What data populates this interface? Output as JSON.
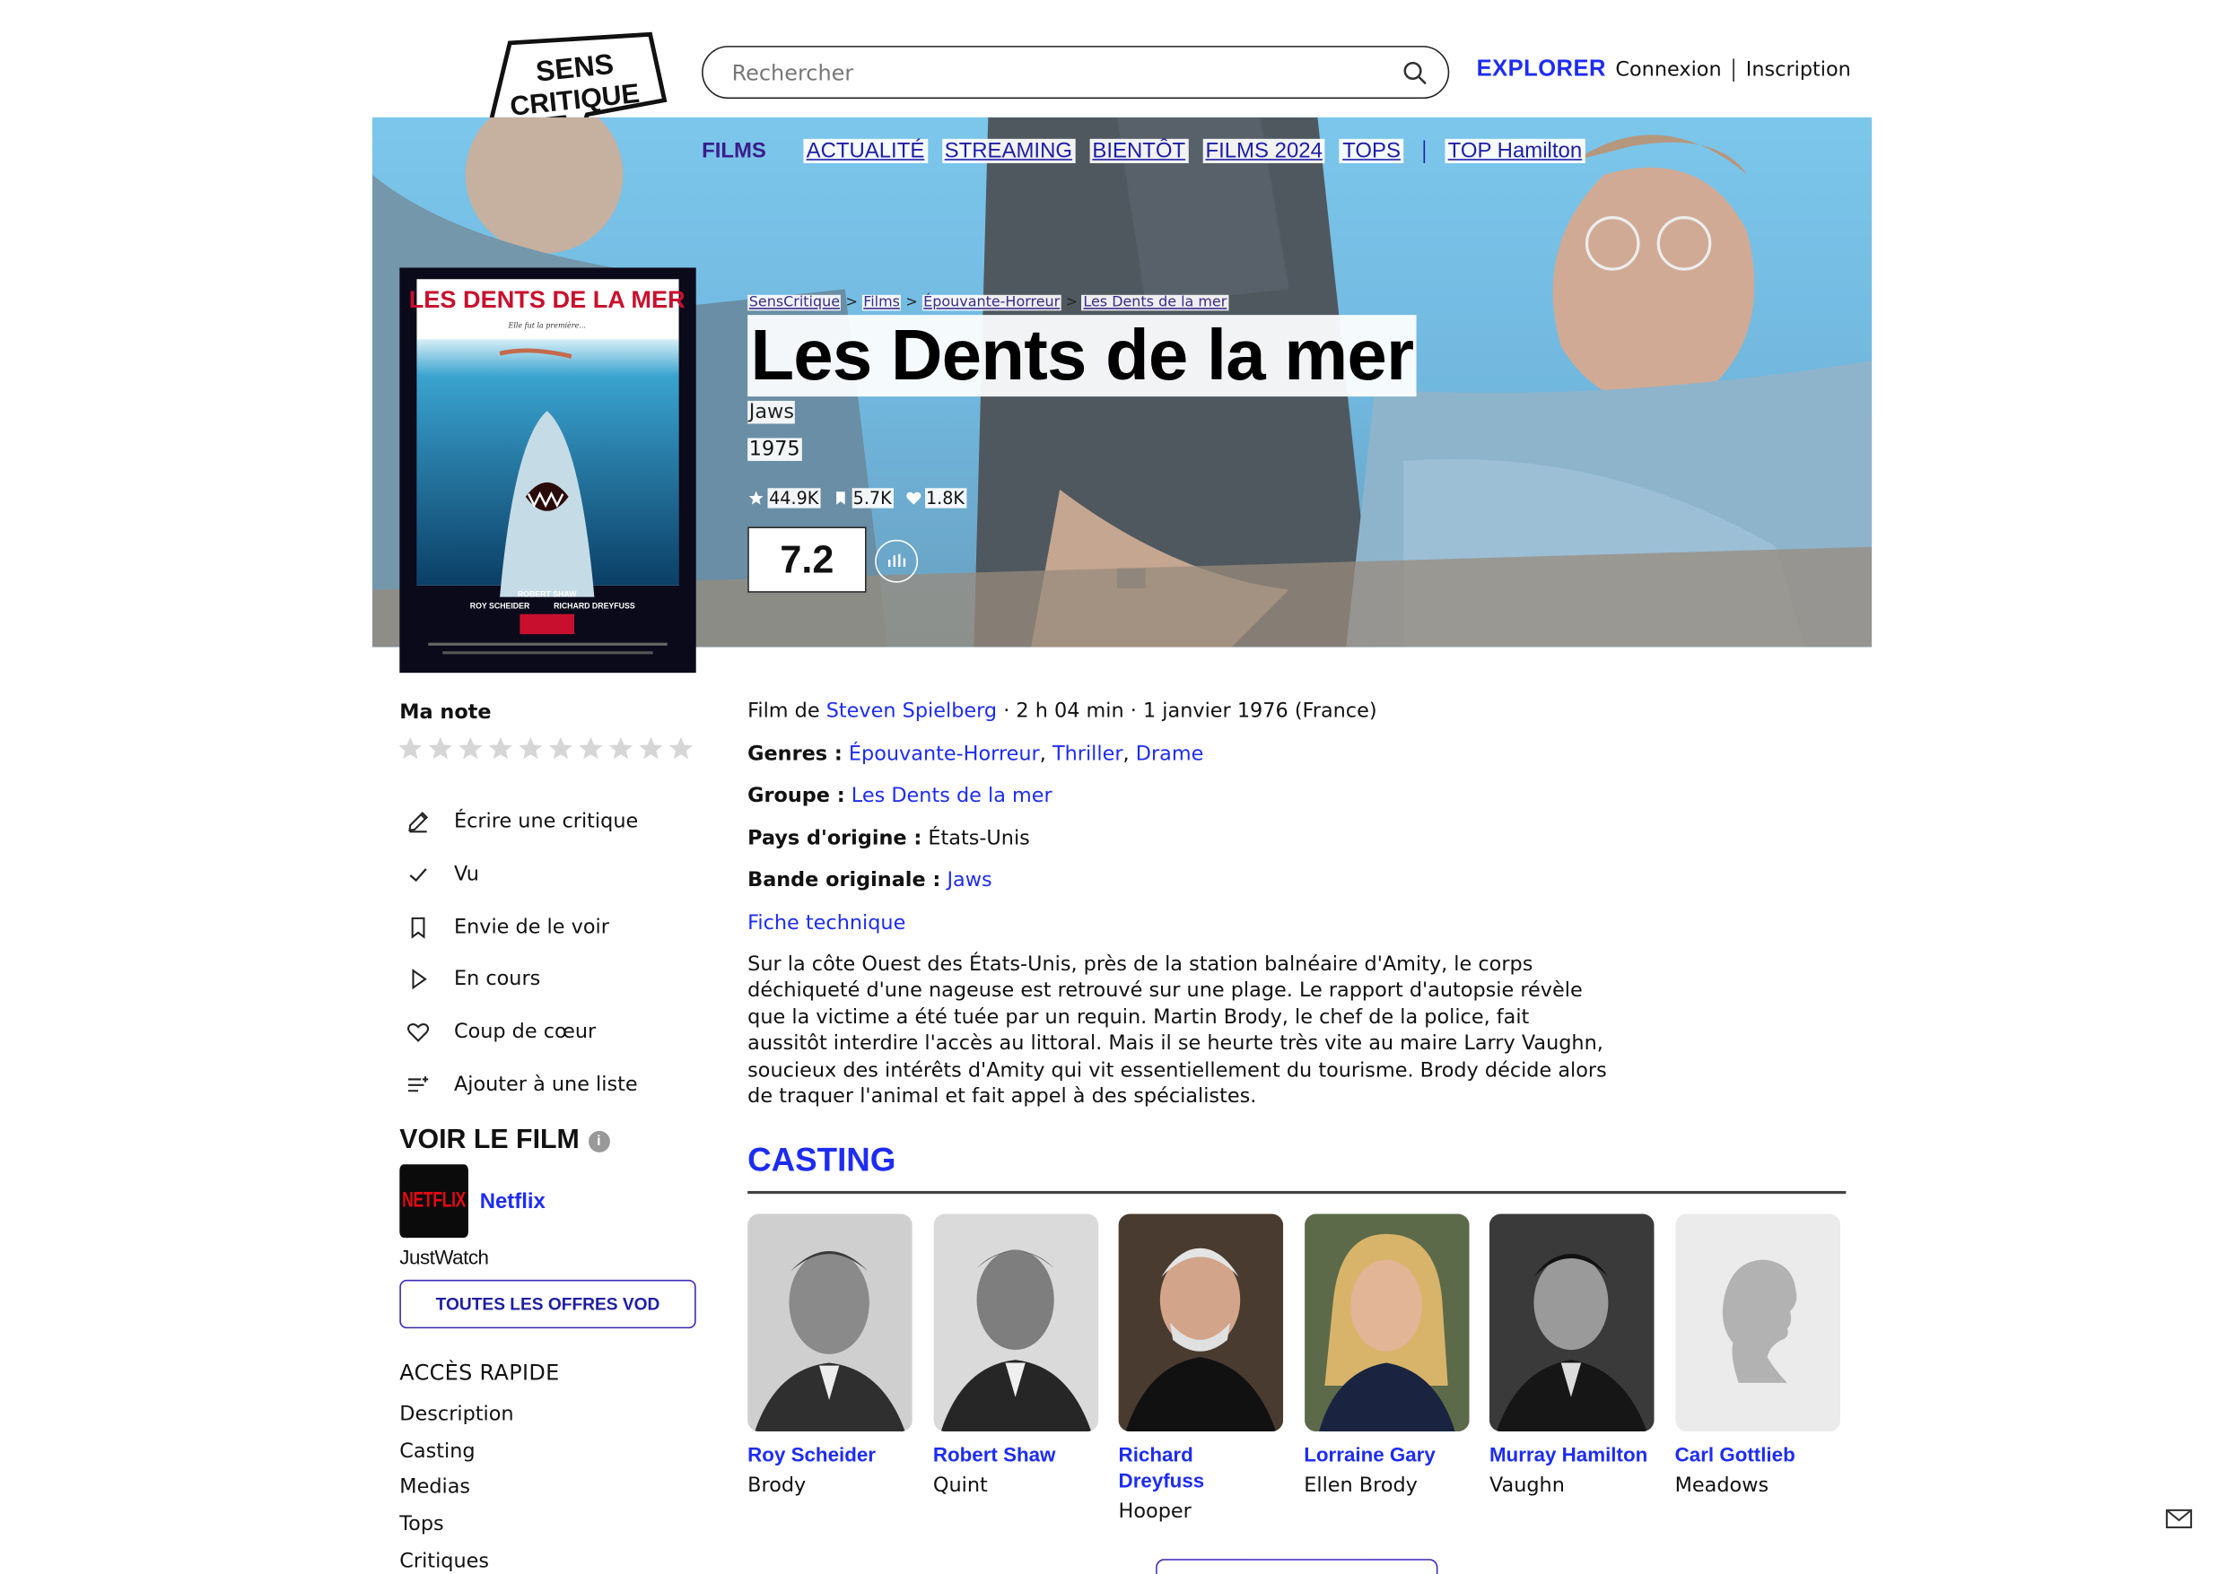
{
  "header": {
    "logo_text": "SENS CRITIQUE",
    "search_placeholder": "Rechercher",
    "explore_label": "EXPLORER",
    "login_label": "Connexion",
    "signup_label": "Inscription"
  },
  "subnav": {
    "section": "FILMS",
    "items": [
      "ACTUALITÉ",
      "STREAMING",
      "BIENTÔT",
      "FILMS 2024",
      "TOPS"
    ],
    "extra": "TOP Hamilton"
  },
  "breadcrumb": [
    "SensCritique",
    "Films",
    "Épouvante-Horreur",
    "Les Dents de la mer"
  ],
  "film": {
    "title": "Les Dents de la mer",
    "original_title": "Jaws",
    "year": "1975",
    "ratings_count": "44.9K",
    "wishlist_count": "5.7K",
    "favorites_count": "1.8K",
    "score": "7.2"
  },
  "poster": {
    "title": "LES DENTS DE LA MER",
    "tagline": "Elle fut la première...",
    "credit1": "ROY SCHEIDER",
    "credit2": "ROBERT SHAW",
    "credit3": "RICHARD DREYFUSS"
  },
  "my_rating": {
    "label": "Ma note",
    "star_count": 10
  },
  "actions": [
    {
      "label": "Écrire une critique",
      "icon": "pencil-icon"
    },
    {
      "label": "Vu",
      "icon": "check-icon"
    },
    {
      "label": "Envie de le voir",
      "icon": "bookmark-icon"
    },
    {
      "label": "En cours",
      "icon": "play-icon"
    },
    {
      "label": "Coup de cœur",
      "icon": "heart-icon"
    },
    {
      "label": "Ajouter à une liste",
      "icon": "list-add-icon"
    }
  ],
  "watch": {
    "heading": "VOIR LE FILM",
    "info_icon": "i",
    "provider_logo": "NETFLIX",
    "provider_name": "Netflix",
    "powered_by": "JustWatch",
    "all_offers": "TOUTES LES OFFRES VOD"
  },
  "quick_access": {
    "heading": "ACCÈS RAPIDE",
    "links": [
      "Description",
      "Casting",
      "Medias",
      "Tops",
      "Critiques"
    ]
  },
  "facts": {
    "film_de": "Film de",
    "director": "Steven Spielberg",
    "details": "· 2 h 04 min · 1 janvier 1976 (France)",
    "genres_label": "Genres :",
    "genres": [
      "Épouvante-Horreur",
      "Thriller",
      "Drame"
    ],
    "groupe_label": "Groupe :",
    "groupe": "Les Dents de la mer",
    "pays_label": "Pays d'origine :",
    "pays": "États-Unis",
    "bo_label": "Bande originale :",
    "bo": "Jaws",
    "fiche": "Fiche technique"
  },
  "synopsis": "Sur la côte Ouest des États-Unis, près de la station balnéaire d'Amity, le corps déchiqueté d'une nageuse est retrouvé sur une plage. Le rapport d'autopsie révèle que la victime a été tuée par un requin. Martin Brody, le chef de la police, fait aussitôt interdire l'accès au littoral. Mais il se heurte très vite au maire Larry Vaughn, soucieux des intérêts d'Amity qui vit essentiellement du tourisme. Brody décide alors de traquer l'animal et fait appel à des spécialistes.",
  "casting": {
    "heading": "CASTING",
    "members": [
      {
        "name": "Roy Scheider",
        "role": "Brody"
      },
      {
        "name": "Robert Shaw",
        "role": "Quint"
      },
      {
        "name": "Richard Dreyfuss",
        "role": "Hooper"
      },
      {
        "name": "Lorraine Gary",
        "role": "Ellen Brody"
      },
      {
        "name": "Murray Hamilton",
        "role": "Vaughn"
      },
      {
        "name": "Carl Gottlieb",
        "role": "Meadows"
      }
    ]
  },
  "colors": {
    "accent": "#1d2cf3",
    "nav_link": "#1d1da6",
    "netflix_red": "#e50914"
  }
}
